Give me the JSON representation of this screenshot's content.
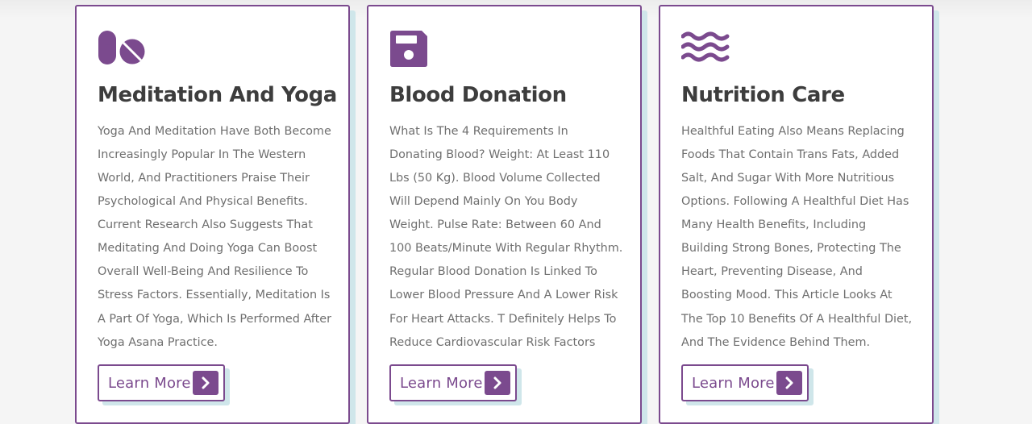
{
  "colors": {
    "accent": "#7b4a8e",
    "title": "#3d3d3d",
    "text": "#6f6f6f",
    "shadow": "#cfe6ea"
  },
  "cards": [
    {
      "icon": "pills-icon",
      "title": "Meditation And Yoga",
      "text": "Yoga And Meditation Have Both Become Increasingly Popular In The Western World, And Practitioners Praise Their Psychological And Physical Benefits. Current Research Also Suggests That Meditating And Doing Yoga Can Boost Overall Well-Being And Resilience To Stress Factors. Essentially, Meditation Is A Part Of Yoga, Which Is Performed After Yoga Asana Practice.",
      "button_label": "Learn More",
      "button_icon": "chevron-right-icon"
    },
    {
      "icon": "floppy-disk-icon",
      "title": "Blood Donation",
      "text": "What Is The 4 Requirements In Donating Blood? Weight: At Least 110 Lbs (50 Kg). Blood Volume Collected Will Depend Mainly On You Body Weight. Pulse Rate: Between 60 And 100 Beats/Minute With Regular Rhythm. Regular Blood Donation Is Linked To Lower Blood Pressure And A Lower Risk For Heart Attacks. T Definitely Helps To Reduce Cardiovascular Risk Factors",
      "button_label": "Learn More",
      "button_icon": "chevron-right-icon"
    },
    {
      "icon": "water-waves-icon",
      "title": "Nutrition Care",
      "text": "Healthful Eating Also Means Replacing Foods That Contain Trans Fats, Added Salt, And Sugar With More Nutritious Options. Following A Healthful Diet Has Many Health Benefits, Including Building Strong Bones, Protecting The Heart, Preventing Disease, And Boosting Mood. This Article Looks At The Top 10 Benefits Of A Healthful Diet, And The Evidence Behind Them.",
      "button_label": "Learn More",
      "button_icon": "chevron-right-icon"
    }
  ]
}
